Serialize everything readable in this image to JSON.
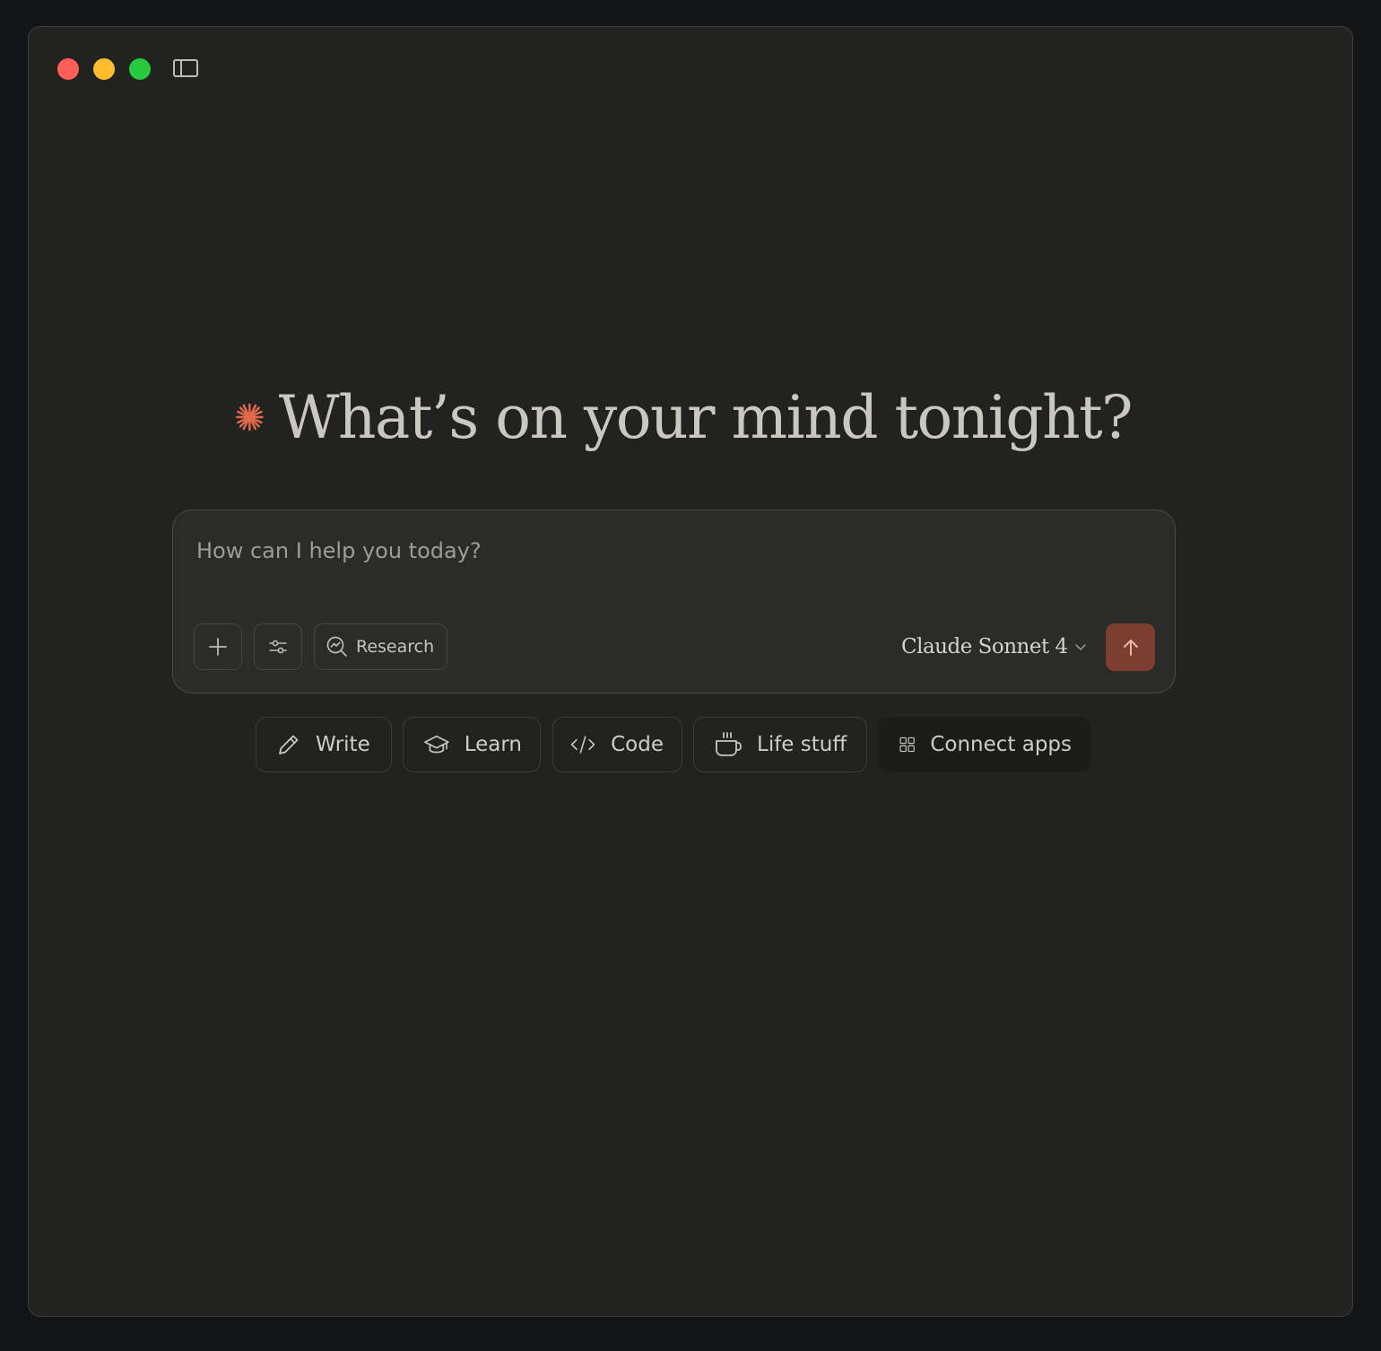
{
  "window": {
    "traffic_lights": [
      "close",
      "minimize",
      "maximize"
    ],
    "sidebar_toggle_icon": "sidebar-icon"
  },
  "greeting": {
    "icon": "claude-spark-icon",
    "text": "What’s on your mind tonight?",
    "accent_color": "#e2694b"
  },
  "composer": {
    "placeholder": "How can I help you today?",
    "value": "",
    "add_icon": "plus-icon",
    "tools_icon": "sliders-icon",
    "research": {
      "icon": "research-search-icon",
      "label": "Research"
    },
    "model": {
      "label": "Claude Sonnet 4",
      "icon": "chevron-down-icon"
    },
    "send": {
      "icon": "arrow-up-icon",
      "color": "#7c3f2f"
    }
  },
  "suggestions": [
    {
      "icon": "pencil-icon",
      "label": "Write"
    },
    {
      "icon": "graduation-cap-icon",
      "label": "Learn"
    },
    {
      "icon": "code-icon",
      "label": "Code"
    },
    {
      "icon": "coffee-cup-icon",
      "label": "Life stuff"
    },
    {
      "icon": "apps-grid-icon",
      "label": "Connect apps"
    }
  ]
}
